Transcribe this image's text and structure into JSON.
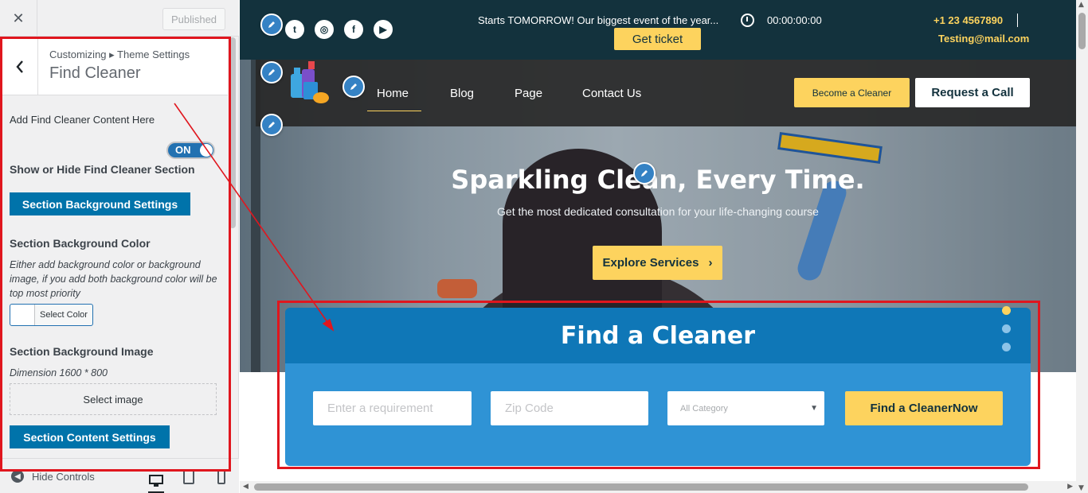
{
  "customizer": {
    "close_glyph": "✕",
    "published_label": "Published",
    "back_glyph": "‹",
    "breadcrumb": "Customizing ▸ Theme Settings",
    "panel_title": "Find Cleaner",
    "add_content_label": "Add Find Cleaner Content Here",
    "toggle_label": "ON",
    "show_hide_label": "Show or Hide Find Cleaner Section",
    "bg_settings_button": "Section Background Settings",
    "bg_color_heading": "Section Background Color",
    "bg_color_desc": "Either add background color or background image, if you add both background color will be top most priority",
    "select_color_label": "Select Color",
    "bg_image_heading": "Section Background Image",
    "dimension_text": "Dimension 1600 * 800",
    "select_image_label": "Select image",
    "content_settings_button": "Section Content Settings",
    "hide_controls_label": "Hide Controls"
  },
  "topbar": {
    "social": [
      {
        "icon": "twitter-icon",
        "glyph": "t"
      },
      {
        "icon": "instagram-icon",
        "glyph": "◎"
      },
      {
        "icon": "facebook-icon",
        "glyph": "f"
      },
      {
        "icon": "youtube-icon",
        "glyph": "▶"
      }
    ],
    "announcement": "Starts TOMORROW! Our biggest event of the year...",
    "countdown": "00:00:00:00",
    "ticket_button": "Get ticket",
    "phone": "+1 23 4567890",
    "email": "Testing@mail.com"
  },
  "nav": {
    "items": [
      "Home",
      "Blog",
      "Page",
      "Contact Us"
    ],
    "become_button": "Become a Cleaner",
    "request_button": "Request a Call"
  },
  "hero": {
    "title": "Sparkling Clean, Every Time.",
    "subtitle": "Get the most dedicated consultation for your life-changing course",
    "explore_button": "Explore Services",
    "explore_arrow": "›"
  },
  "find": {
    "heading": "Find a Cleaner",
    "requirement_placeholder": "Enter a requirement",
    "zip_placeholder": "Zip Code",
    "category_selected": "All Category",
    "submit_button": "Find a CleanerNow"
  },
  "colors": {
    "accent_yellow": "#fdd35e",
    "topbar_dark": "#13323d",
    "find_head": "#0f77b7",
    "find_body": "#2f93d5",
    "wp_blue": "#0073aa",
    "highlight_red": "#e0161e"
  }
}
